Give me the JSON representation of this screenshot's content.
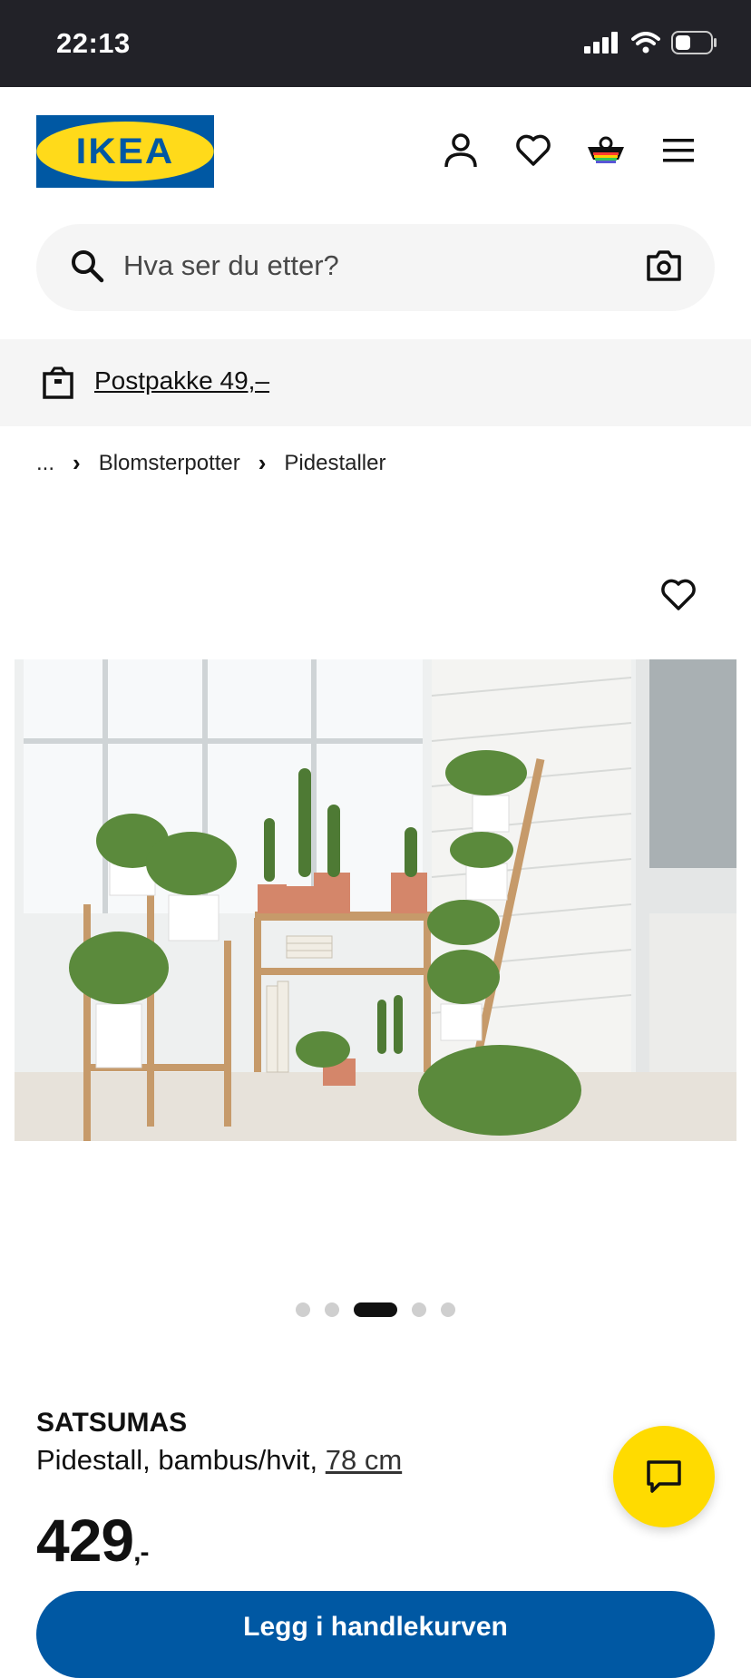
{
  "status_bar": {
    "time": "22:13"
  },
  "header": {
    "logo_text": "IKEA",
    "icons": [
      "user-icon",
      "heart-icon",
      "basket-icon",
      "menu-icon"
    ]
  },
  "search": {
    "placeholder": "Hva ser du etter?"
  },
  "promo": {
    "text": "Postpakke 49,–"
  },
  "breadcrumb": {
    "ellipsis": "...",
    "items": [
      "Blomsterpotter",
      "Pidestaller"
    ]
  },
  "carousel": {
    "count": 5,
    "active_index": 2
  },
  "product": {
    "name": "SATSUMAS",
    "description": "Pidestall, bambus/hvit, ",
    "size": "78 cm",
    "price": "429",
    "price_suffix": ",-"
  },
  "cta": {
    "label": "Legg i handlekurven"
  },
  "colors": {
    "brand_blue": "#0058a3",
    "brand_yellow": "#ffda1a",
    "chat_yellow": "#ffdb00"
  }
}
